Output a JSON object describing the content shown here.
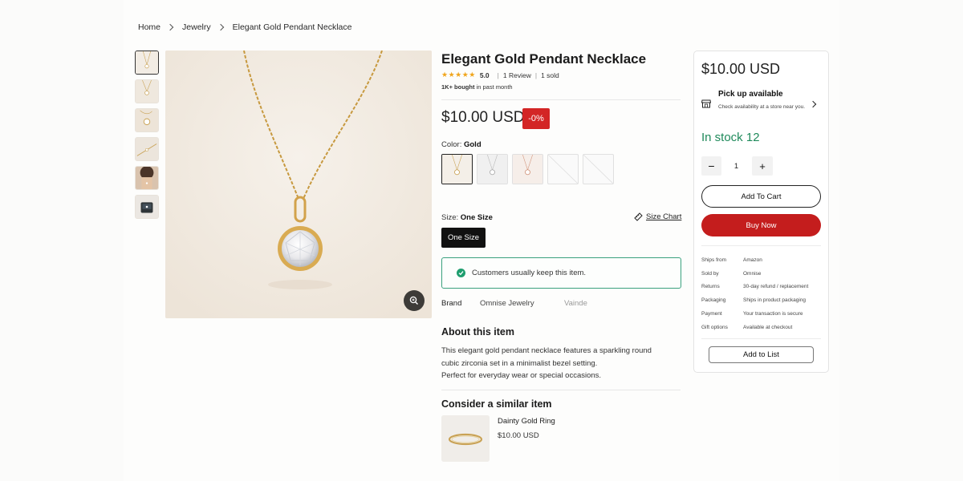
{
  "breadcrumb": {
    "home": "Home",
    "category": "Jewelry",
    "current": "Elegant Gold Pendant Necklace"
  },
  "product": {
    "title": "Elegant Gold Pendant Necklace",
    "stars": "★★★★★",
    "rating": "5.0",
    "reviews": "1 Review",
    "sold": "1 sold",
    "bought_bold": "1K+ bought",
    "bought_rest": " in past month",
    "price": "$10.00 USD",
    "discount": "-0%",
    "color_label": "Color: ",
    "color_value": "Gold",
    "size_label": "Size: ",
    "size_value": "One Size",
    "size_chart": "Size Chart",
    "size_option": "One Size",
    "keep_note": "Customers usually keep this item.",
    "brand_label": "Brand",
    "brand_value": "Omnise Jewelry",
    "brand_value_2": "Vainde",
    "about_heading": "About this item",
    "about_line1": "This elegant gold pendant necklace features a sparkling round",
    "about_line2": "cubic zirconia set in a minimalist bezel setting.",
    "about_line3": "Perfect for everyday wear or special occasions."
  },
  "similar": {
    "heading": "Consider a similar item",
    "name": "Dainty Gold Ring",
    "price": "$10.00 USD"
  },
  "buybox": {
    "price": "$10.00 USD",
    "pickup_title": "Pick up available",
    "pickup_sub": "Check availability at a store near you.",
    "stock": "In stock 12",
    "qty_minus": "−",
    "qty": "1",
    "qty_plus": "+",
    "add_to_cart": "Add To Cart",
    "buy_now": "Buy Now",
    "specs": [
      {
        "k": "Ships from",
        "v": "Amazon"
      },
      {
        "k": "Sold by",
        "v": "Omnise"
      },
      {
        "k": "Returns",
        "v": "30-day refund / replacement"
      },
      {
        "k": "Packaging",
        "v": "Ships in product packaging"
      },
      {
        "k": "Payment",
        "v": "Your transaction is secure"
      },
      {
        "k": "Gift options",
        "v": "Available at checkout"
      }
    ],
    "add_to_list": "Add to List"
  },
  "colors": {
    "accent_red": "#c41d1d",
    "stock_green": "#1f8a5b",
    "star": "#f0a51c"
  },
  "icons": [
    "chevron-right-icon",
    "zoom-icon",
    "ruler-icon",
    "check-icon",
    "store-icon"
  ]
}
